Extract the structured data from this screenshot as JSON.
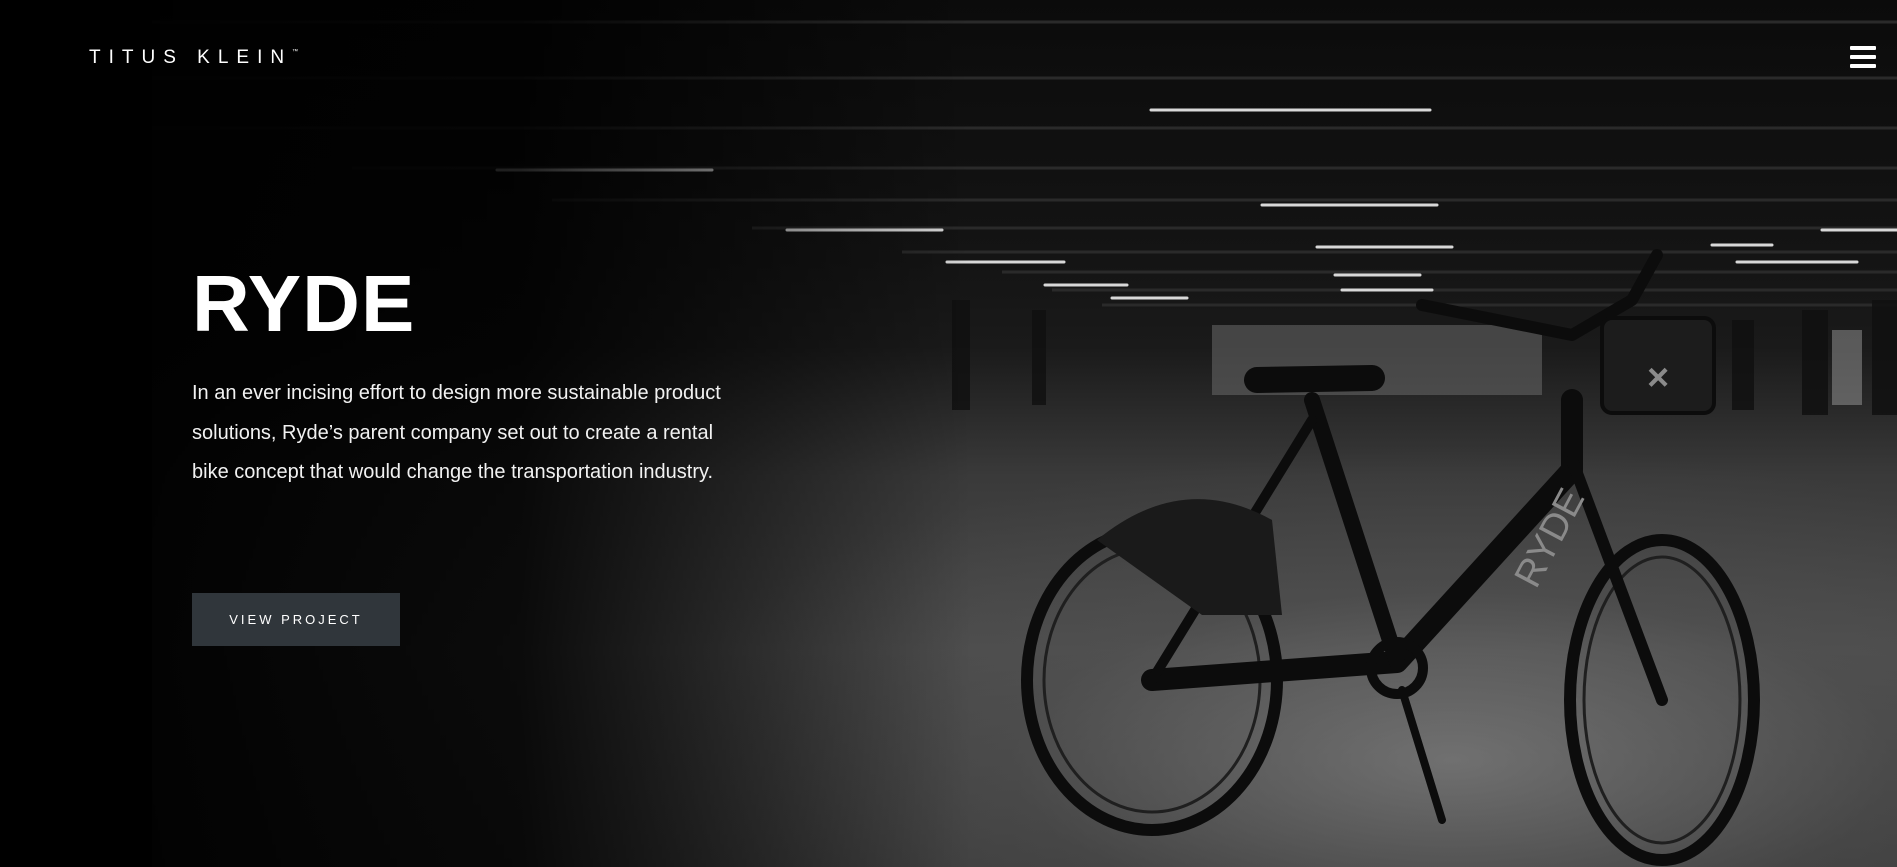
{
  "header": {
    "logo_text": "TITUS KLEIN",
    "logo_mark": "™",
    "menu_icon": "hamburger-menu-icon"
  },
  "hero": {
    "title": "RYDE",
    "description": "In an ever incising effort to design more sustainable product solutions, Ryde’s parent company set out to create a rental bike concept that would change the transportation industry.",
    "cta_label": "VIEW PROJECT",
    "bike_frame_text": "RYDE"
  },
  "colors": {
    "background": "#000000",
    "button_bg": "#30363b",
    "text": "#ffffff"
  }
}
